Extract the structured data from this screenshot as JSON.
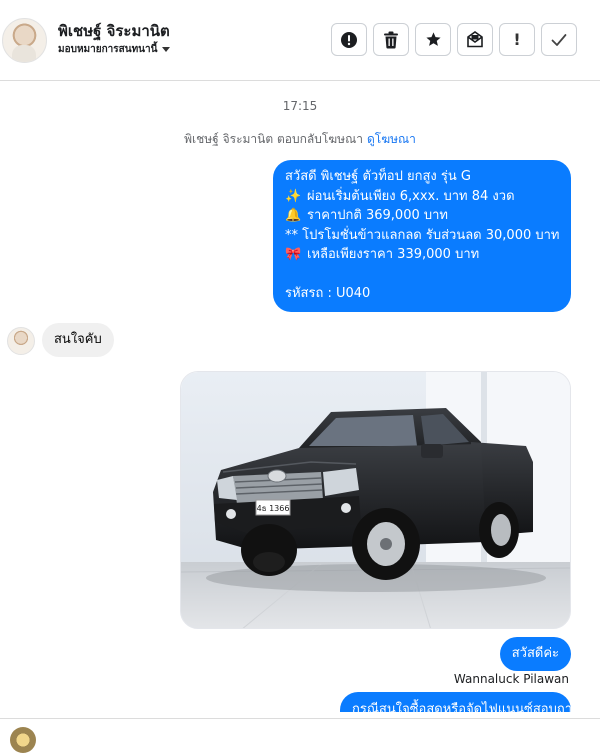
{
  "header": {
    "contact_name": "พิเชษฐ์ จิระมานิต",
    "assign_label": "มอบหมายการสนทนานี้",
    "actions": [
      {
        "name": "report-spam-button",
        "icon": "alert-circle-icon"
      },
      {
        "name": "delete-button",
        "icon": "trash-icon"
      },
      {
        "name": "star-button",
        "icon": "star-icon"
      },
      {
        "name": "mark-unread-button",
        "icon": "envelope-icon"
      },
      {
        "name": "follow-up-button",
        "icon": "exclamation-icon",
        "glyph": "!"
      },
      {
        "name": "mark-done-button",
        "icon": "check-icon"
      }
    ]
  },
  "conversation": {
    "timestamp": "17:15",
    "ad_reply_text": "พิเชษฐ์ จิระมานิต ตอบกลับโฆษณา",
    "ad_link_label": "ดูโฆษณา",
    "message1": {
      "lines": [
        {
          "emoji": "",
          "text": "สวัสดี พิเชษฐ์ ตัวท็อป ยกสูง รุ่น G"
        },
        {
          "emoji": "✨",
          "text": "ผ่อนเริ่มต้นเพียง 6,xxx. บาท 84 งวด"
        },
        {
          "emoji": "🔔",
          "text": "ราคาปกติ 369,000 บาท"
        },
        {
          "emoji": "",
          "text": "** โปรโมชั่นข้าวแลกลด รับส่วนลด 30,000 บาท"
        },
        {
          "emoji": "🎀",
          "text": "เหลือเพียงราคา 339,000 บาท"
        },
        {
          "emoji": "",
          "text": ""
        },
        {
          "emoji": "",
          "text": "รหัสรถ : U040"
        }
      ]
    },
    "reply_in": "สนใจคับ",
    "photo": {
      "plate_text": "4ธ 1366"
    },
    "reply_out": "สวัสดีค่ะ",
    "sender_name": "Wannaluck Pilawan",
    "cut_message": "กรณีสนใจซื้อสดหรือจัดไฟแนนซ์สอบถาม"
  },
  "colors": {
    "outgoing_bubble": "#0a7cff",
    "incoming_bubble": "#f0f0f0",
    "link": "#1877f2"
  }
}
